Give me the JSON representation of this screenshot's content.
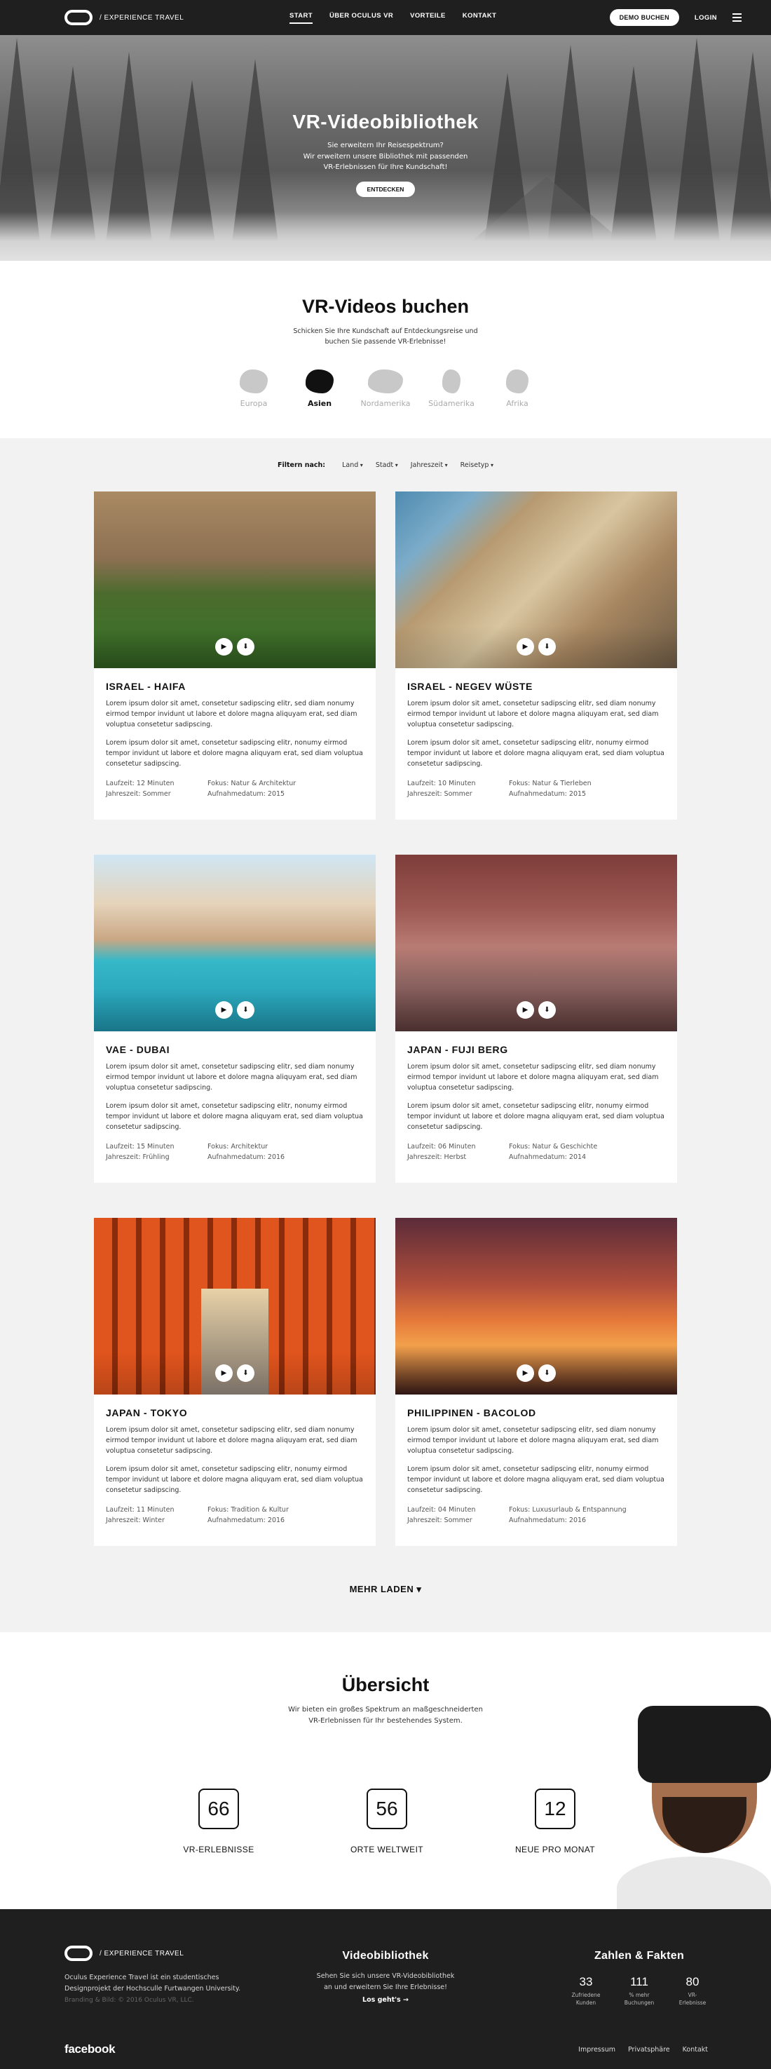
{
  "nav": {
    "brand": "/ EXPERIENCE TRAVEL",
    "links": [
      "START",
      "ÜBER OCULUS VR",
      "VORTEILE",
      "KONTAKT"
    ],
    "demo_label": "DEMO BUCHEN",
    "login_label": "LOGIN"
  },
  "hero": {
    "title": "VR-Videobibliothek",
    "subtitle_lines": [
      "Sie erweitern Ihr Reisespektrum?",
      "Wir erweitern unsere Bibliothek mit passenden",
      "VR-Erlebnissen für Ihre Kundschaft!"
    ],
    "button_label": "ENTDECKEN"
  },
  "book": {
    "title": "VR-Videos buchen",
    "subtitle_lines": [
      "Schicken Sie Ihre Kundschaft auf Entdeckungsreise und",
      "buchen Sie passende VR-Erlebnisse!"
    ],
    "continents": [
      "Europa",
      "Asien",
      "Nordamerika",
      "Südamerika",
      "Afrika"
    ],
    "active_continent": "Asien"
  },
  "filter": {
    "label": "Filtern nach:",
    "items": [
      "Land",
      "Stadt",
      "Jahreszeit",
      "Reisetyp"
    ]
  },
  "cards": [
    {
      "title": "ISRAEL - HAIFA",
      "text1": "Lorem ipsum dolor sit amet, consetetur sadipscing elitr, sed diam nonumy eirmod tempor invidunt ut labore et dolore magna aliquyam erat, sed diam voluptua consetetur sadipscing.",
      "text2": "Lorem ipsum dolor sit amet, consetetur sadipscing elitr, nonumy eirmod tempor invidunt ut labore et dolore magna aliquyam erat, sed diam voluptua consetetur sadipscing.",
      "laufzeit": "Laufzeit: 12 Minuten",
      "fokus": "Fokus: Natur & Architektur",
      "jahreszeit": "Jahreszeit: Sommer",
      "datum": "Aufnahmedatum: 2015"
    },
    {
      "title": "ISRAEL - NEGEV WÜSTE",
      "text1": "Lorem ipsum dolor sit amet, consetetur sadipscing elitr, sed diam nonumy eirmod tempor invidunt ut labore et dolore magna aliquyam erat, sed diam voluptua consetetur sadipscing.",
      "text2": "Lorem ipsum dolor sit amet, consetetur sadipscing elitr, nonumy eirmod tempor invidunt ut labore et dolore magna aliquyam erat, sed diam voluptua consetetur sadipscing.",
      "laufzeit": "Laufzeit: 10 Minuten",
      "fokus": "Fokus: Natur & Tierleben",
      "jahreszeit": "Jahreszeit: Sommer",
      "datum": "Aufnahmedatum: 2015"
    },
    {
      "title": "VAE - DUBAI",
      "text1": "Lorem ipsum dolor sit amet, consetetur sadipscing elitr, sed diam nonumy eirmod tempor invidunt ut labore et dolore magna aliquyam erat, sed diam voluptua consetetur sadipscing.",
      "text2": "Lorem ipsum dolor sit amet, consetetur sadipscing elitr, nonumy eirmod tempor invidunt ut labore et dolore magna aliquyam erat, sed diam voluptua consetetur sadipscing.",
      "laufzeit": "Laufzeit: 15 Minuten",
      "fokus": "Fokus: Architektur",
      "jahreszeit": "Jahreszeit: Frühling",
      "datum": "Aufnahmedatum: 2016"
    },
    {
      "title": "JAPAN - FUJI BERG",
      "text1": "Lorem ipsum dolor sit amet, consetetur sadipscing elitr, sed diam nonumy eirmod tempor invidunt ut labore et dolore magna aliquyam erat, sed diam voluptua consetetur sadipscing.",
      "text2": "Lorem ipsum dolor sit amet, consetetur sadipscing elitr, nonumy eirmod tempor invidunt ut labore et dolore magna aliquyam erat, sed diam voluptua consetetur sadipscing.",
      "laufzeit": "Laufzeit: 06 Minuten",
      "fokus": "Fokus: Natur & Geschichte",
      "jahreszeit": "Jahreszeit: Herbst",
      "datum": "Aufnahmedatum: 2014"
    },
    {
      "title": "JAPAN - TOKYO",
      "text1": "Lorem ipsum dolor sit amet, consetetur sadipscing elitr, sed diam nonumy eirmod tempor invidunt ut labore et dolore magna aliquyam erat, sed diam voluptua consetetur sadipscing.",
      "text2": "Lorem ipsum dolor sit amet, consetetur sadipscing elitr, nonumy eirmod tempor invidunt ut labore et dolore magna aliquyam erat, sed diam voluptua consetetur sadipscing.",
      "laufzeit": "Laufzeit: 11 Minuten",
      "fokus": "Fokus: Tradition & Kultur",
      "jahreszeit": "Jahreszeit: Winter",
      "datum": "Aufnahmedatum: 2016"
    },
    {
      "title": "PHILIPPINEN - BACOLOD",
      "text1": "Lorem ipsum dolor sit amet, consetetur sadipscing elitr, sed diam nonumy eirmod tempor invidunt ut labore et dolore magna aliquyam erat, sed diam voluptua consetetur sadipscing.",
      "text2": "Lorem ipsum dolor sit amet, consetetur sadipscing elitr, nonumy eirmod tempor invidunt ut labore et dolore magna aliquyam erat, sed diam voluptua consetetur sadipscing.",
      "laufzeit": "Laufzeit: 04 Minuten",
      "fokus": "Fokus: Luxusurlaub & Entspannung",
      "jahreszeit": "Jahreszeit: Sommer",
      "datum": "Aufnahmedatum: 2016"
    }
  ],
  "more_label": "MEHR LADEN",
  "overview": {
    "title": "Übersicht",
    "subtitle_lines": [
      "Wir bieten ein großes Spektrum an maßgeschneiderten",
      "VR-Erlebnissen für Ihr bestehendes System."
    ],
    "stats": [
      {
        "value": "66",
        "label": "VR-ERLEBNISSE"
      },
      {
        "value": "56",
        "label": "ORTE WELTWEIT"
      },
      {
        "value": "12",
        "label": "NEUE PRO MONAT"
      }
    ]
  },
  "footer": {
    "brand": "/ EXPERIENCE TRAVEL",
    "desc_lines": [
      "Oculus Experience Travel ist ein studentisches",
      "Designprojekt der Hochsculle Furtwangen University."
    ],
    "copyright": "Branding & Bild: © 2016 Oculus VR, LLC.",
    "lib_title": "Videobibliothek",
    "lib_lines": [
      "Sehen Sie sich unsere VR-Videobibliothek",
      "an und erweitern Sie Ihre Erlebnisse!"
    ],
    "lib_link": "Los geht's →",
    "facts_title": "Zahlen & Fakten",
    "facts": [
      {
        "value": "33",
        "label": "Zufriedene Kunden"
      },
      {
        "value": "111",
        "label": "% mehr Buchungen"
      },
      {
        "value": "80",
        "label": "VR-Erlebnisse"
      }
    ],
    "facebook": "facebook",
    "links": [
      "Impressum",
      "Privatsphäre",
      "Kontakt"
    ]
  },
  "colors": {
    "dark": "#1f1f1f",
    "page_bg": "#f2f2f2",
    "text": "#222222"
  }
}
